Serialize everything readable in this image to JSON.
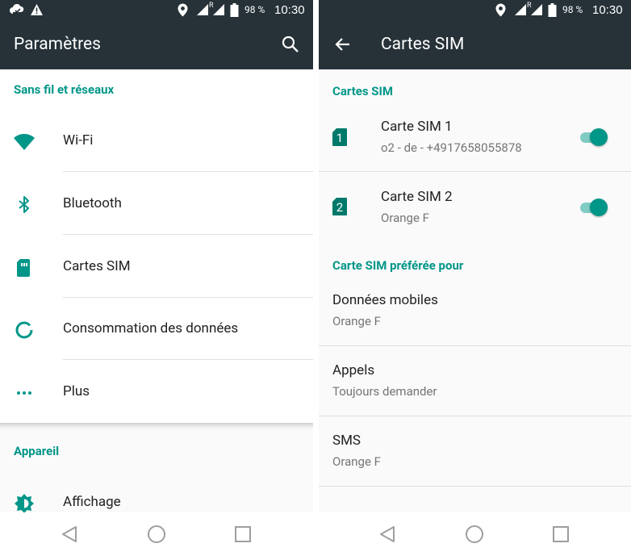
{
  "status": {
    "battery": "98 %",
    "time": "10:30",
    "signal_roaming": "R"
  },
  "left": {
    "title": "Paramètres",
    "section_wireless": "Sans fil et réseaux",
    "items": [
      {
        "label": "Wi-Fi",
        "icon": "wifi-icon"
      },
      {
        "label": "Bluetooth",
        "icon": "bluetooth-icon"
      },
      {
        "label": "Cartes SIM",
        "icon": "sim-card-icon"
      },
      {
        "label": "Consommation des données",
        "icon": "data-usage-icon"
      },
      {
        "label": "Plus",
        "icon": "more-horiz-icon"
      }
    ],
    "section_device": "Appareil",
    "device_items": [
      {
        "label": "Affichage",
        "icon": "brightness-icon"
      }
    ]
  },
  "right": {
    "title": "Cartes SIM",
    "section_sim": "Cartes SIM",
    "sims": [
      {
        "name": "Carte SIM 1",
        "detail": "o2 - de - +4917658055878",
        "slot": "1",
        "enabled": true
      },
      {
        "name": "Carte SIM 2",
        "detail": "Orange F",
        "slot": "2",
        "enabled": true
      }
    ],
    "section_pref": "Carte SIM préférée pour",
    "prefs": [
      {
        "title": "Données mobiles",
        "value": "Orange F"
      },
      {
        "title": "Appels",
        "value": "Toujours demander"
      },
      {
        "title": "SMS",
        "value": "Orange F"
      }
    ]
  },
  "colors": {
    "appbar": "#263238",
    "accent": "#009688",
    "accent_light": "#80cbc4"
  }
}
